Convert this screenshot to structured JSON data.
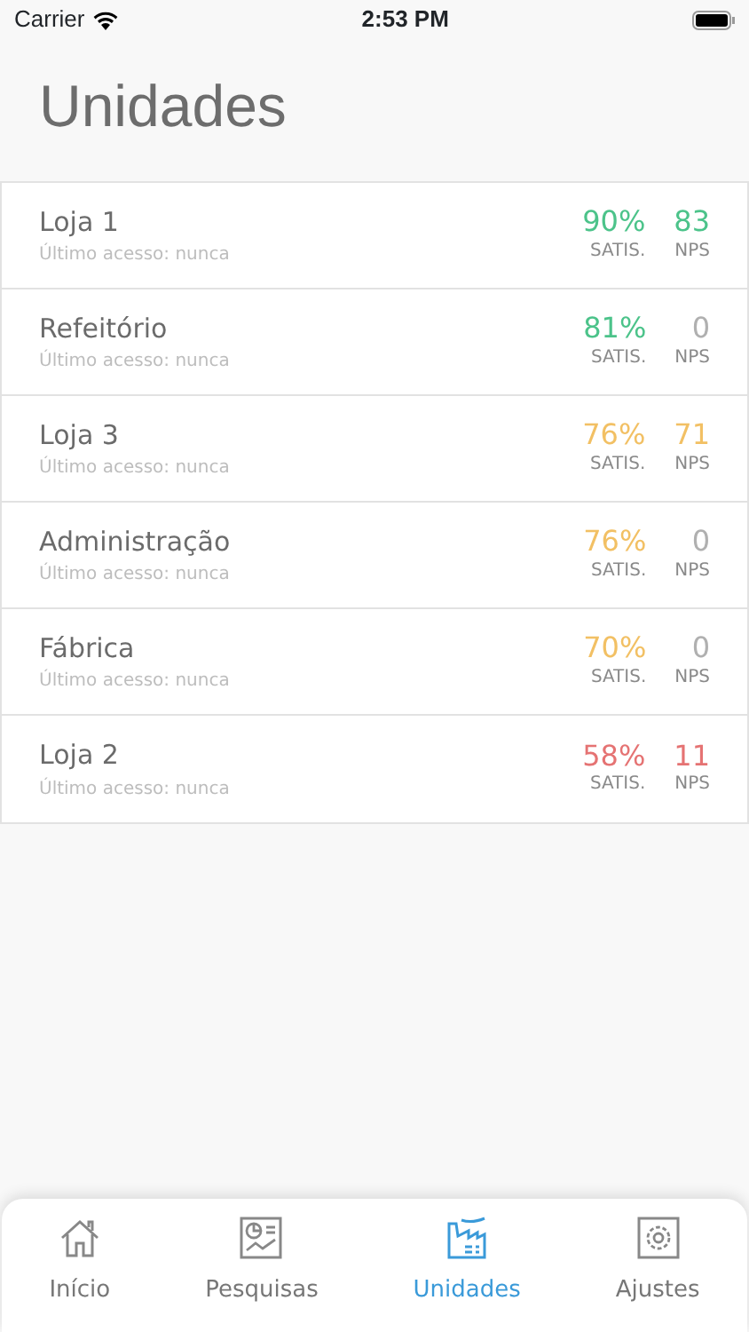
{
  "status_bar": {
    "carrier": "Carrier",
    "time": "2:53 PM"
  },
  "title": "Unidades",
  "units": [
    {
      "name": "Loja 1",
      "last_access": "Último acesso: nunca",
      "satis": {
        "value": "90%",
        "color": "#4cc38a",
        "label": "SATIS."
      },
      "nps": {
        "value": "83",
        "color": "#4cc38a",
        "label": "NPS"
      }
    },
    {
      "name": "Refeitório",
      "last_access": "Último acesso: nunca",
      "satis": {
        "value": "81%",
        "color": "#4cc38a",
        "label": "SATIS."
      },
      "nps": {
        "value": "0",
        "color": "#b0b0b0",
        "label": "NPS"
      }
    },
    {
      "name": "Loja 3",
      "last_access": "Último acesso: nunca",
      "satis": {
        "value": "76%",
        "color": "#f2c064",
        "label": "SATIS."
      },
      "nps": {
        "value": "71",
        "color": "#f2c064",
        "label": "NPS"
      }
    },
    {
      "name": "Administração",
      "last_access": "Último acesso: nunca",
      "satis": {
        "value": "76%",
        "color": "#f2c064",
        "label": "SATIS."
      },
      "nps": {
        "value": "0",
        "color": "#b0b0b0",
        "label": "NPS"
      }
    },
    {
      "name": "Fábrica",
      "last_access": "Último acesso: nunca",
      "satis": {
        "value": "70%",
        "color": "#f2c064",
        "label": "SATIS."
      },
      "nps": {
        "value": "0",
        "color": "#b0b0b0",
        "label": "NPS"
      }
    },
    {
      "name": "Loja 2",
      "last_access": "Último acesso: nunca",
      "satis": {
        "value": "58%",
        "color": "#e57373",
        "label": "SATIS."
      },
      "nps": {
        "value": "11",
        "color": "#e57373",
        "label": "NPS"
      }
    }
  ],
  "tabs": [
    {
      "label": "Início",
      "kind": "home",
      "selected": false
    },
    {
      "label": "Pesquisas",
      "kind": "report",
      "selected": false
    },
    {
      "label": "Unidades",
      "kind": "factory",
      "selected": true
    },
    {
      "label": "Ajustes",
      "kind": "settings",
      "selected": false
    }
  ]
}
